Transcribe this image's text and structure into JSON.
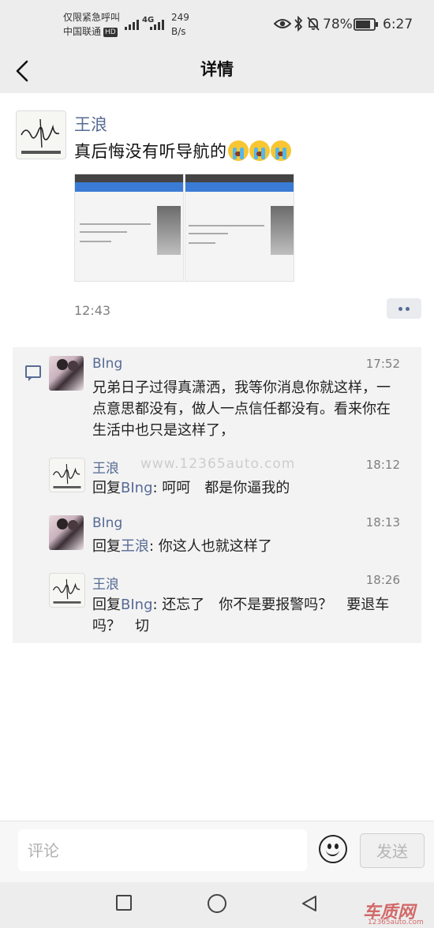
{
  "status_bar": {
    "emergency": "仅限紧急呼叫",
    "carrier": "中国联通",
    "hd": "HD",
    "network": "4G",
    "speed_value": "249",
    "speed_unit": "B/s",
    "battery": "78%",
    "time": "6:27"
  },
  "header": {
    "title": "详情"
  },
  "post": {
    "author": "王浪",
    "text": "真后悔没有听导航的",
    "time": "12:43"
  },
  "comments": [
    {
      "name": "BIng",
      "time": "17:52",
      "text": "兄弟日子过得真潇洒，我等你消息你就这样，一点意思都没有，做人一点信任都没有。看来你在生活中也只是这样了，"
    },
    {
      "name": "王浪",
      "time": "18:12",
      "reply_prefix": "回复",
      "reply_to": "BIng",
      "text": ": 呵呵　都是你逼我的"
    },
    {
      "name": "BIng",
      "time": "18:13",
      "reply_prefix": "回复",
      "reply_to": "王浪",
      "text": ": 你这人也就这样了"
    },
    {
      "name": "王浪",
      "time": "18:26",
      "reply_prefix": "回复",
      "reply_to": "BIng",
      "text": ": 还忘了　你不是要报警吗？　要退车吗？　切"
    }
  ],
  "watermarks": {
    "site": "www.12365auto.com",
    "logo": "车质网",
    "logo_sub": "12365auto.com"
  },
  "input_bar": {
    "placeholder": "评论",
    "send_label": "发送"
  },
  "colors": {
    "link": "#576b95",
    "header_bg": "#ededed",
    "comment_bg": "#f3f3f3"
  }
}
